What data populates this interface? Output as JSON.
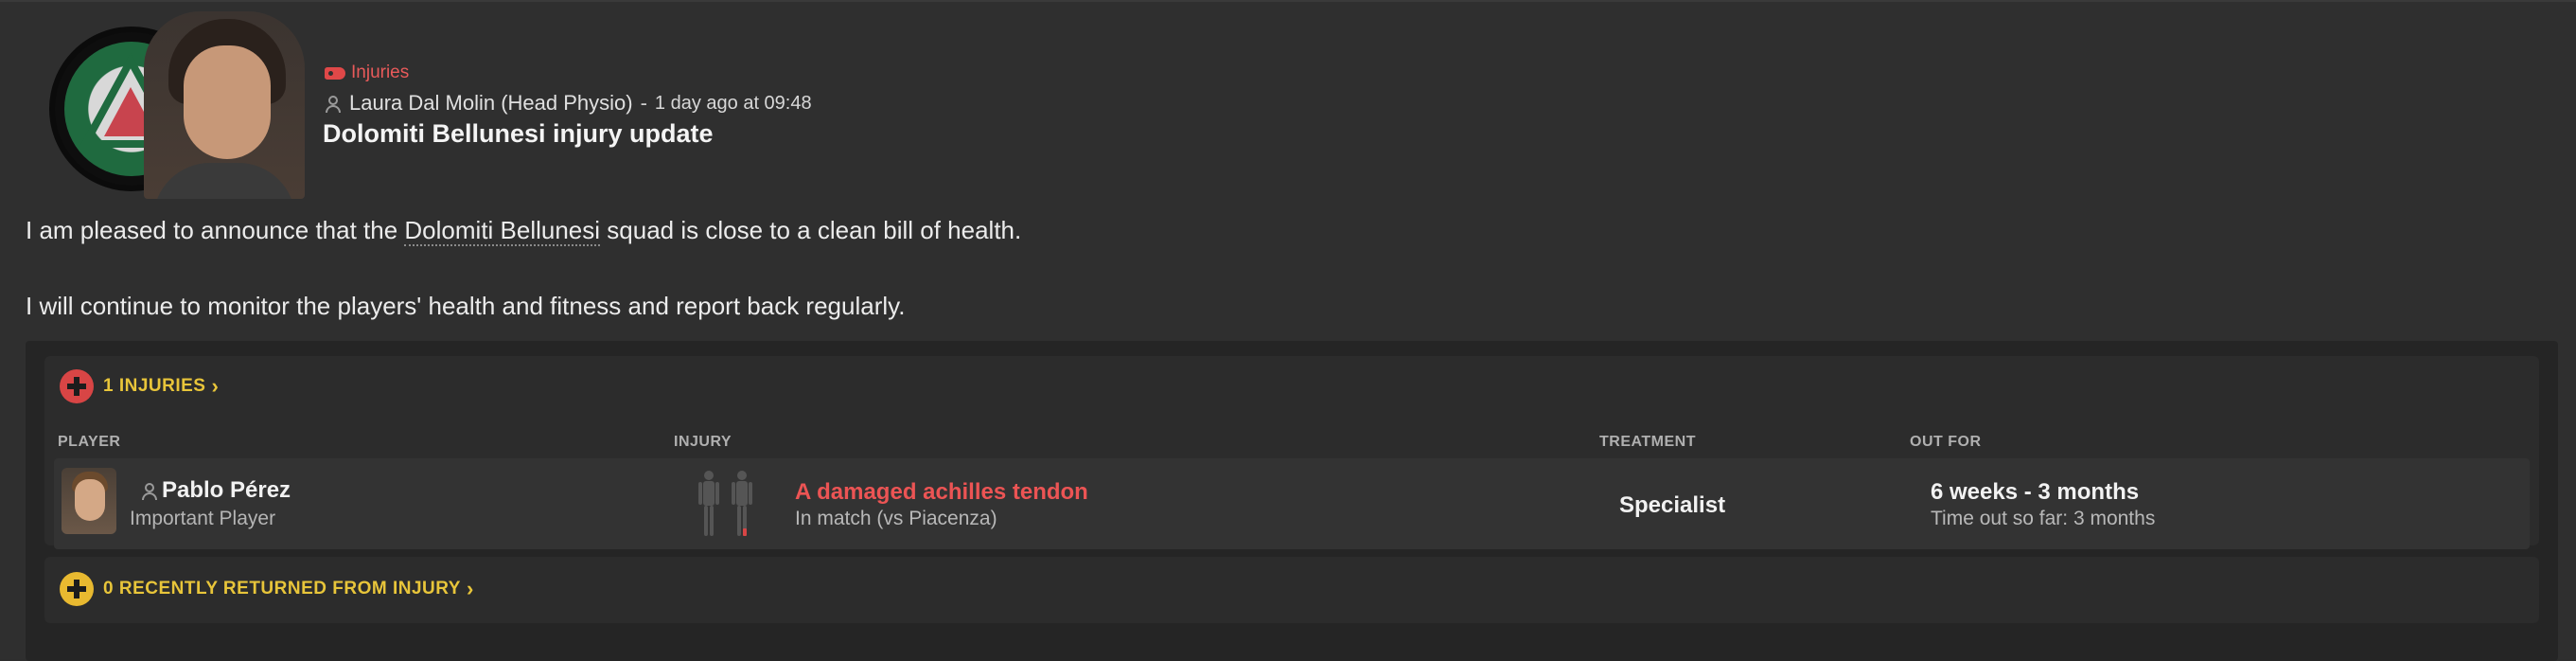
{
  "message": {
    "category": "Injuries",
    "sender": "Laura Dal Molin (Head Physio)",
    "separator": "-",
    "time": "1 day ago at 09:48",
    "subject": "Dolomiti Bellunesi injury update",
    "paragraph1_before": "I am pleased to announce that the ",
    "club_name": "Dolomiti Bellunesi",
    "paragraph1_after": " squad is close to a clean bill of health.",
    "paragraph2": "I will continue to monitor the players' health and fitness and report back regularly."
  },
  "injuries": {
    "header": "1 INJURIES",
    "columns": {
      "player": "PLAYER",
      "injury": "INJURY",
      "treatment": "TREATMENT",
      "out_for": "OUT FOR"
    },
    "rows": [
      {
        "player_name": "Pablo Pérez",
        "player_role": "Important Player",
        "injury": "A damaged achilles tendon",
        "injury_context": "In match (vs Piacenza)",
        "treatment": "Specialist",
        "out_for": "6 weeks - 3 months",
        "time_out_so_far": "Time out so far: 3 months"
      }
    ]
  },
  "returned": {
    "header": "0 RECENTLY RETURNED FROM INJURY"
  },
  "colors": {
    "accent_yellow": "#e8c53a",
    "injury_red": "#ec5454",
    "background": "#2f2f2f"
  },
  "icons": [
    "tag-icon",
    "person-icon",
    "injury-cross-icon",
    "returned-cross-icon",
    "chevron-right-icon",
    "body-figure-icon"
  ]
}
